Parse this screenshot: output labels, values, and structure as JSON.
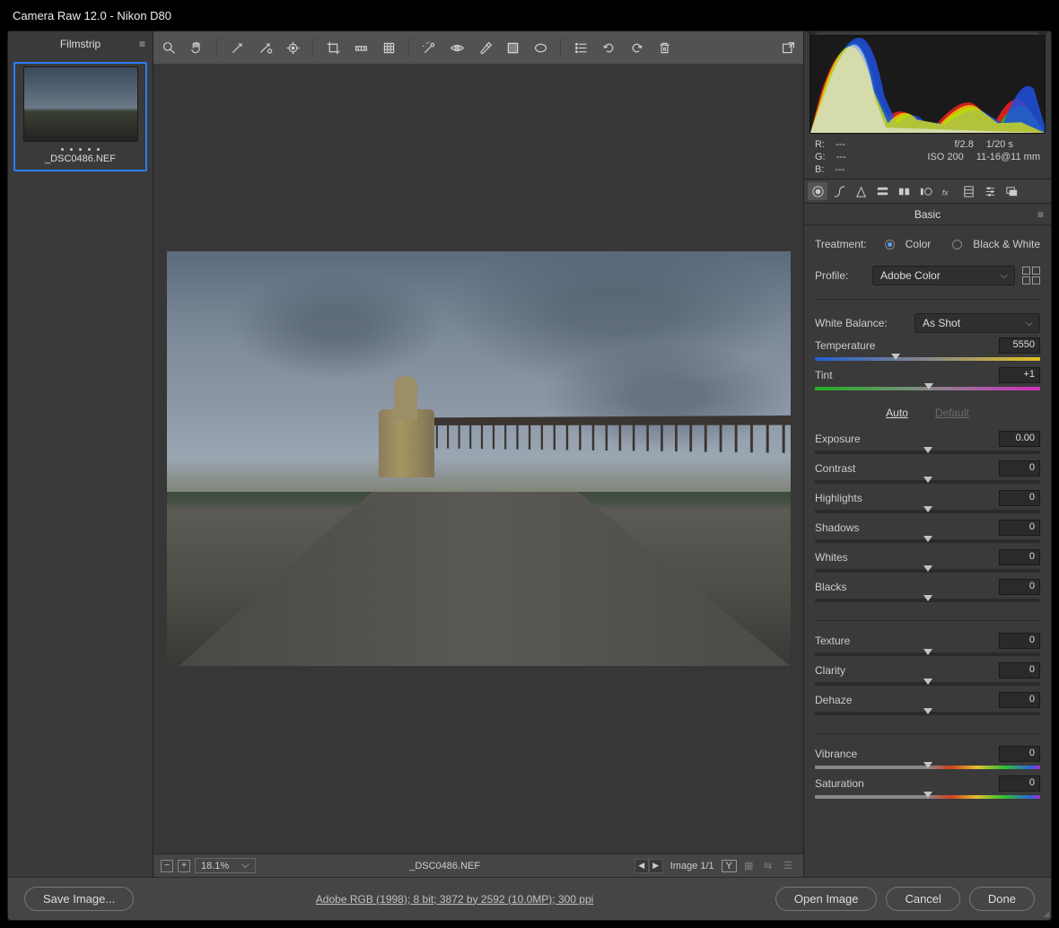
{
  "title": "Camera Raw 12.0  -  Nikon D80",
  "filmstrip": {
    "header": "Filmstrip",
    "thumb_label": "_DSC0486.NEF"
  },
  "statusbar": {
    "zoom": "18.1%",
    "filename": "_DSC0486.NEF",
    "image_index": "Image 1/1",
    "y_label": "Y"
  },
  "info": {
    "r_label": "R:",
    "r_val": "---",
    "g_label": "G:",
    "g_val": "---",
    "b_label": "B:",
    "b_val": "---",
    "aperture": "f/2.8",
    "shutter": "1/20 s",
    "iso": "ISO 200",
    "lens": "11-16@11 mm"
  },
  "panel": {
    "title": "Basic",
    "treatment_label": "Treatment:",
    "color_label": "Color",
    "bw_label": "Black & White",
    "profile_label": "Profile:",
    "profile_value": "Adobe Color",
    "wb_label": "White Balance:",
    "wb_value": "As Shot",
    "auto": "Auto",
    "default": "Default",
    "sliders": {
      "temperature": {
        "label": "Temperature",
        "value": "5550",
        "pos": 36
      },
      "tint": {
        "label": "Tint",
        "value": "+1",
        "pos": 50.5
      },
      "exposure": {
        "label": "Exposure",
        "value": "0.00",
        "pos": 50
      },
      "contrast": {
        "label": "Contrast",
        "value": "0",
        "pos": 50
      },
      "highlights": {
        "label": "Highlights",
        "value": "0",
        "pos": 50
      },
      "shadows": {
        "label": "Shadows",
        "value": "0",
        "pos": 50
      },
      "whites": {
        "label": "Whites",
        "value": "0",
        "pos": 50
      },
      "blacks": {
        "label": "Blacks",
        "value": "0",
        "pos": 50
      },
      "texture": {
        "label": "Texture",
        "value": "0",
        "pos": 50
      },
      "clarity": {
        "label": "Clarity",
        "value": "0",
        "pos": 50
      },
      "dehaze": {
        "label": "Dehaze",
        "value": "0",
        "pos": 50
      },
      "vibrance": {
        "label": "Vibrance",
        "value": "0",
        "pos": 50
      },
      "saturation": {
        "label": "Saturation",
        "value": "0",
        "pos": 50
      }
    }
  },
  "footer": {
    "save": "Save Image...",
    "workflow": "Adobe RGB (1998); 8 bit; 3872 by 2592 (10.0MP); 300 ppi",
    "open": "Open Image",
    "cancel": "Cancel",
    "done": "Done"
  }
}
